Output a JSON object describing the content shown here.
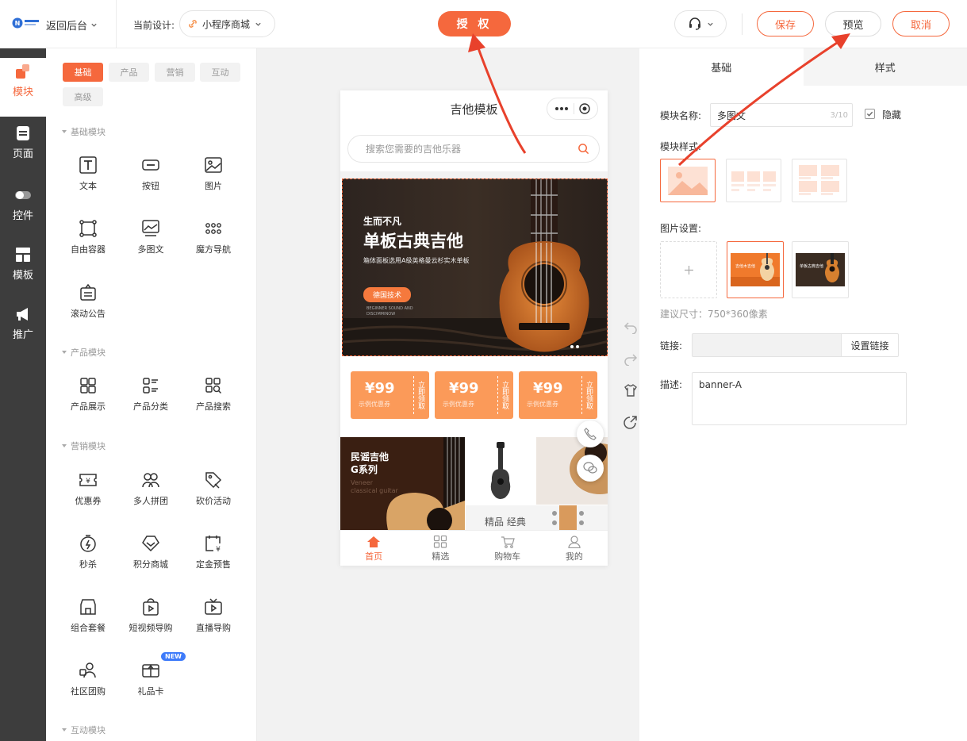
{
  "header": {
    "back_label": "返回后台",
    "current_design_label": "当前设计:",
    "current_design_value": "小程序商城",
    "auth_label": "授 权",
    "save_label": "保存",
    "preview_label": "预览",
    "cancel_label": "取消"
  },
  "nav": {
    "items": [
      {
        "label": "模块",
        "icon": "module-icon"
      },
      {
        "label": "页面",
        "icon": "page-icon"
      },
      {
        "label": "控件",
        "icon": "toggle-icon"
      },
      {
        "label": "模板",
        "icon": "template-icon"
      },
      {
        "label": "推广",
        "icon": "megaphone-icon"
      }
    ]
  },
  "component_panel": {
    "tabs": [
      "基础",
      "产品",
      "营销",
      "互动",
      "高级"
    ],
    "sections": [
      {
        "title": "基础模块",
        "items": [
          "文本",
          "按钮",
          "图片",
          "自由容器",
          "多图文",
          "魔方导航",
          "滚动公告"
        ]
      },
      {
        "title": "产品模块",
        "items": [
          "产品展示",
          "产品分类",
          "产品搜索"
        ]
      },
      {
        "title": "营销模块",
        "items": [
          "优惠券",
          "多人拼团",
          "砍价活动",
          "秒杀",
          "积分商城",
          "定金预售",
          "组合套餐",
          "短视频导购",
          "直播导购",
          "社区团购",
          "礼品卡"
        ]
      },
      {
        "title": "互动模块",
        "items": []
      }
    ],
    "new_badge": "NEW"
  },
  "phone": {
    "title": "吉他模板",
    "search_placeholder": "搜索您需要的吉他乐器",
    "banner": {
      "line1": "生而不凡",
      "line2": "单板古典吉他",
      "line3": "箱体面板选用A级英格曼云杉实木单板",
      "pill": "德国技术",
      "small": "BEGINNER SOUND AND DISCIMMINOW"
    },
    "coupons": [
      {
        "amount": "¥99",
        "sub": "示例优惠券",
        "side": "立即领取"
      },
      {
        "amount": "¥99",
        "sub": "示例优惠券",
        "side": "立即领取"
      },
      {
        "amount": "¥99",
        "sub": "示例优惠券",
        "side": "立即领取"
      }
    ],
    "grid": {
      "title1": "民谣吉他",
      "title2": "G系列",
      "sub1": "Veneer",
      "sub2": "classical guitar",
      "bottom": "精品 经典"
    },
    "tabbar": [
      {
        "label": "首页",
        "icon": "home-icon"
      },
      {
        "label": "精选",
        "icon": "grid-icon"
      },
      {
        "label": "购物车",
        "icon": "cart-icon"
      },
      {
        "label": "我的",
        "icon": "user-icon"
      }
    ]
  },
  "settings": {
    "tab_basic": "基础",
    "tab_style": "样式",
    "name_label": "模块名称:",
    "name_value": "多图文",
    "name_count": "3/10",
    "hide_label": "隐藏",
    "style_label": "模块样式:",
    "image_label": "图片设置:",
    "thumb_text_1": "吉他木吉他",
    "thumb_text_2": "单板古典吉他",
    "size_hint": "建议尺寸：750*360像素",
    "link_label": "链接:",
    "link_button": "设置链接",
    "desc_label": "描述:",
    "desc_value": "banner-A"
  },
  "colors": {
    "accent": "#f5683d",
    "nav_bg": "#3d3d3d",
    "arrow": "#e8412c"
  }
}
